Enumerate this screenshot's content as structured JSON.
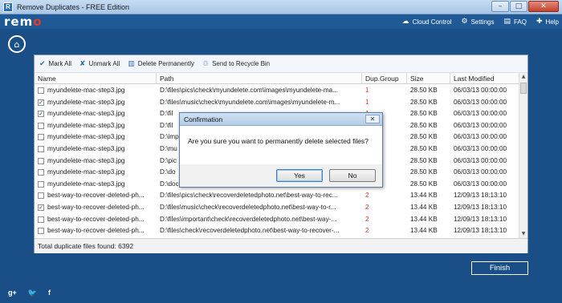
{
  "window": {
    "title": "Remove Duplicates - FREE Edition"
  },
  "header": {
    "logo_text": "rem",
    "logo_accent": "o",
    "menu": [
      {
        "label": "Cloud Control",
        "icon": "cloud-icon"
      },
      {
        "label": "Settings",
        "icon": "gear-icon"
      },
      {
        "label": "FAQ",
        "icon": "book-icon"
      },
      {
        "label": "Help",
        "icon": "help-icon"
      }
    ]
  },
  "toolbar": {
    "mark_all": "Mark All",
    "unmark_all": "Unmark All",
    "delete_permanently": "Delete Permanently",
    "send_to_recycle_bin": "Send to Recycle Bin"
  },
  "table": {
    "columns": [
      "Name",
      "Path",
      "Dup.Group",
      "Size",
      "Last Modified"
    ],
    "rows": [
      {
        "checked": false,
        "name": "myundelete-mac-step3.jpg",
        "path": "D:\\files\\pics\\check\\myundelete.com\\images\\myundelete-ma...",
        "group": "1",
        "size": "28.50 KB",
        "modified": "06/03/13 00:00:00"
      },
      {
        "checked": true,
        "name": "myundelete-mac-step3.jpg",
        "path": "D:\\files\\music\\check\\myundelete.com\\images\\myundelete-m...",
        "group": "1",
        "size": "28.50 KB",
        "modified": "06/03/13 00:00:00"
      },
      {
        "checked": true,
        "name": "myundelete-mac-step3.jpg",
        "path": "D:\\fil",
        "group": "1",
        "size": "28.50 KB",
        "modified": "06/03/13 00:00:00"
      },
      {
        "checked": false,
        "name": "myundelete-mac-step3.jpg",
        "path": "D:\\fil",
        "group": "1",
        "size": "28.50 KB",
        "modified": "06/03/13 00:00:00"
      },
      {
        "checked": false,
        "name": "myundelete-mac-step3.jpg",
        "path": "D:\\imp",
        "group": "1",
        "size": "28.50 KB",
        "modified": "06/03/13 00:00:00"
      },
      {
        "checked": false,
        "name": "myundelete-mac-step3.jpg",
        "path": "D:\\mu",
        "group": "1",
        "size": "28.50 KB",
        "modified": "06/03/13 00:00:00"
      },
      {
        "checked": false,
        "name": "myundelete-mac-step3.jpg",
        "path": "D:\\pic",
        "group": "1",
        "size": "28.50 KB",
        "modified": "06/03/13 00:00:00"
      },
      {
        "checked": false,
        "name": "myundelete-mac-step3.jpg",
        "path": "D:\\do",
        "group": "1",
        "size": "28.50 KB",
        "modified": "06/03/13 00:00:00"
      },
      {
        "checked": false,
        "name": "myundelete-mac-step3.jpg",
        "path": "D:\\documents\\check\\myundelete.com\\images\\myundelete-...",
        "group": "1",
        "size": "28.50 KB",
        "modified": "06/03/13 00:00:00"
      },
      {
        "checked": false,
        "name": "best-way-to-recover-deleted-ph...",
        "path": "D:\\files\\pics\\check\\recoverdeletedphoto.net\\best-way-to-rec...",
        "group": "2",
        "size": "13.44 KB",
        "modified": "12/09/13 18:13:10"
      },
      {
        "checked": true,
        "name": "best-way-to-recover-deleted-ph...",
        "path": "D:\\files\\music\\check\\recoverdeletedphoto.net\\best-way-to-r...",
        "group": "2",
        "size": "13.44 KB",
        "modified": "12/09/13 18:13:10"
      },
      {
        "checked": false,
        "name": "best-way-to-recover-deleted-ph...",
        "path": "D:\\files\\important\\check\\recoverdeletedphoto.net\\best-way-...",
        "group": "2",
        "size": "13.44 KB",
        "modified": "12/09/13 18:13:10"
      },
      {
        "checked": false,
        "name": "best-way-to-recover-deleted-ph...",
        "path": "D:\\files\\check\\recoverdeletedphoto.net\\best-way-to-recover-...",
        "group": "2",
        "size": "13.44 KB",
        "modified": "12/09/13 18:13:10"
      }
    ]
  },
  "footer": {
    "total_text": "Total duplicate files found: 6392"
  },
  "dialog": {
    "title": "Confirmation",
    "message": "Are you sure you want to permanently delete selected files?",
    "yes": "Yes",
    "no": "No"
  },
  "finish_label": "Finish",
  "social": [
    "g+",
    "twitter",
    "f"
  ]
}
